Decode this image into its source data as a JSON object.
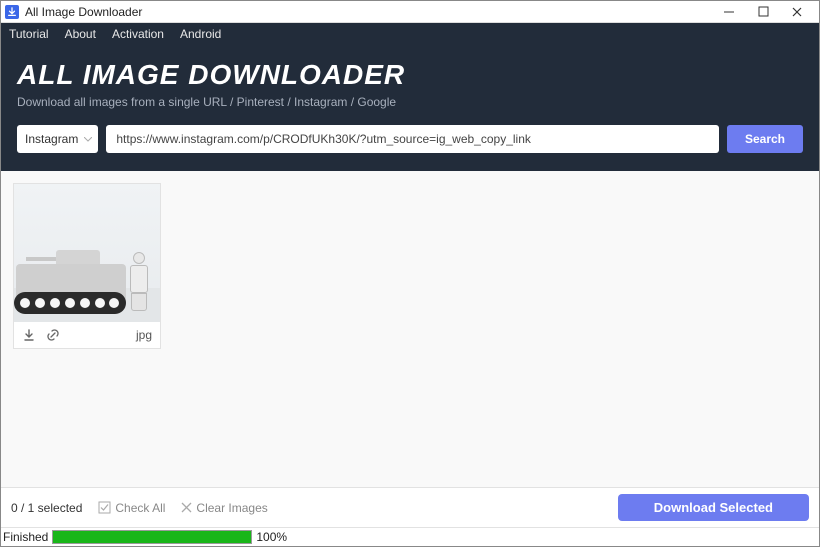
{
  "window": {
    "title": "All Image Downloader"
  },
  "menu": {
    "items": [
      "Tutorial",
      "About",
      "Activation",
      "Android"
    ]
  },
  "header": {
    "title": "ALL IMAGE DOWNLOADER",
    "subtitle": "Download all images from a single URL / Pinterest / Instagram / Google"
  },
  "search": {
    "source_label": "Instagram",
    "url_value": "https://www.instagram.com/p/CRODfUKh30K/?utm_source=ig_web_copy_link",
    "button_label": "Search"
  },
  "results": {
    "items": [
      {
        "ext": "jpg"
      }
    ]
  },
  "footer": {
    "selection_text": "0 / 1 selected",
    "check_all_label": "Check All",
    "clear_label": "Clear Images",
    "download_label": "Download Selected"
  },
  "status": {
    "label": "Finished",
    "percent_text": "100%",
    "percent_value": 100
  },
  "colors": {
    "accent": "#6d7cf0",
    "header_bg": "#222c3a",
    "progress_fill": "#19b619"
  }
}
